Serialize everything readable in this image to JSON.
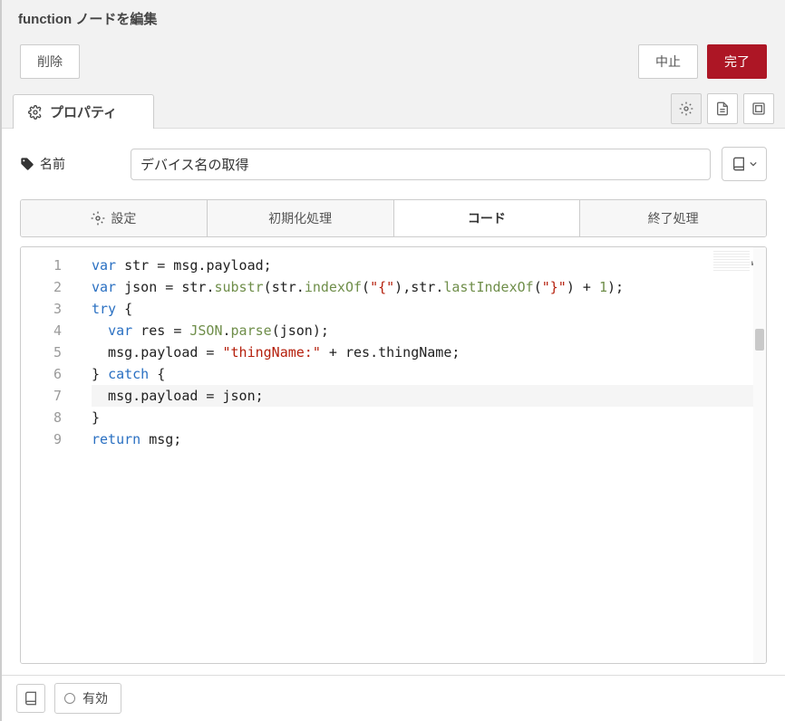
{
  "colors": {
    "accent": "#ad1625"
  },
  "header": {
    "title": "function ノードを編集"
  },
  "buttons": {
    "delete": "削除",
    "cancel": "中止",
    "done": "完了"
  },
  "tabs": {
    "properties": "プロパティ"
  },
  "toolbar_icons": {
    "settings": "gear-icon",
    "doc": "document-icon",
    "appearance": "appearance-icon"
  },
  "name_row": {
    "label": "名前",
    "value": "デバイス名の取得",
    "placeholder": "名前",
    "library_icon": "book-icon"
  },
  "sub_tabs": [
    {
      "id": "setup",
      "label": "設定",
      "has_gear": true
    },
    {
      "id": "onstart",
      "label": "初期化処理",
      "has_gear": false
    },
    {
      "id": "code",
      "label": "コード",
      "has_gear": false,
      "active": true
    },
    {
      "id": "onstop",
      "label": "終了処理",
      "has_gear": false
    }
  ],
  "editor": {
    "gutter": [
      "1",
      "2",
      "3",
      "4",
      "5",
      "6",
      "7",
      "8",
      "9"
    ],
    "current_line": 7,
    "code_tokens": [
      [
        {
          "t": "kw",
          "s": "var"
        },
        {
          "t": "pn",
          "s": " str "
        },
        {
          "t": "pn",
          "s": "="
        },
        {
          "t": "pn",
          "s": " msg"
        },
        {
          "t": "pn",
          "s": "."
        },
        {
          "t": "ident",
          "s": "payload"
        },
        {
          "t": "pn",
          "s": ";"
        }
      ],
      [
        {
          "t": "kw",
          "s": "var"
        },
        {
          "t": "pn",
          "s": " json "
        },
        {
          "t": "pn",
          "s": "="
        },
        {
          "t": "pn",
          "s": " str"
        },
        {
          "t": "pn",
          "s": "."
        },
        {
          "t": "fn",
          "s": "substr"
        },
        {
          "t": "pn",
          "s": "("
        },
        {
          "t": "pn",
          "s": "str"
        },
        {
          "t": "pn",
          "s": "."
        },
        {
          "t": "fn",
          "s": "indexOf"
        },
        {
          "t": "pn",
          "s": "("
        },
        {
          "t": "str",
          "s": "\"{\""
        },
        {
          "t": "pn",
          "s": ")"
        },
        {
          "t": "pn",
          "s": ","
        },
        {
          "t": "pn",
          "s": "str"
        },
        {
          "t": "pn",
          "s": "."
        },
        {
          "t": "fn",
          "s": "lastIndexOf"
        },
        {
          "t": "pn",
          "s": "("
        },
        {
          "t": "str",
          "s": "\"}\""
        },
        {
          "t": "pn",
          "s": ")"
        },
        {
          "t": "pn",
          "s": " + "
        },
        {
          "t": "fn",
          "s": "1"
        },
        {
          "t": "pn",
          "s": ");"
        }
      ],
      [
        {
          "t": "kw",
          "s": "try"
        },
        {
          "t": "pn",
          "s": " {"
        }
      ],
      [
        {
          "t": "pn",
          "s": "  "
        },
        {
          "t": "kw",
          "s": "var"
        },
        {
          "t": "pn",
          "s": " res "
        },
        {
          "t": "pn",
          "s": "="
        },
        {
          "t": "pn",
          "s": " "
        },
        {
          "t": "fn",
          "s": "JSON"
        },
        {
          "t": "pn",
          "s": "."
        },
        {
          "t": "fn",
          "s": "parse"
        },
        {
          "t": "pn",
          "s": "("
        },
        {
          "t": "ident",
          "s": "json"
        },
        {
          "t": "pn",
          "s": ");"
        }
      ],
      [
        {
          "t": "pn",
          "s": "  msg"
        },
        {
          "t": "pn",
          "s": "."
        },
        {
          "t": "ident",
          "s": "payload"
        },
        {
          "t": "pn",
          "s": " = "
        },
        {
          "t": "str",
          "s": "\"thingName:\""
        },
        {
          "t": "pn",
          "s": " + res"
        },
        {
          "t": "pn",
          "s": "."
        },
        {
          "t": "ident",
          "s": "thingName"
        },
        {
          "t": "pn",
          "s": ";"
        }
      ],
      [
        {
          "t": "pn",
          "s": "} "
        },
        {
          "t": "kw",
          "s": "catch"
        },
        {
          "t": "pn",
          "s": " {"
        }
      ],
      [
        {
          "t": "pn",
          "s": "  msg"
        },
        {
          "t": "pn",
          "s": "."
        },
        {
          "t": "ident",
          "s": "payload"
        },
        {
          "t": "pn",
          "s": " = json;"
        }
      ],
      [
        {
          "t": "pn",
          "s": "}"
        }
      ],
      [
        {
          "t": "kw",
          "s": "return"
        },
        {
          "t": "pn",
          "s": " msg;"
        }
      ]
    ]
  },
  "footer": {
    "library_icon": "book-icon",
    "enabled_label": "有効"
  }
}
